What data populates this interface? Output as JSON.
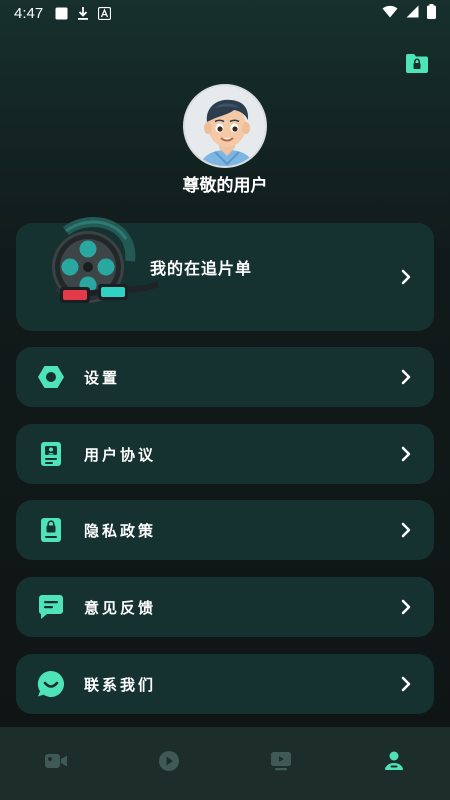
{
  "status_bar": {
    "time": "4:47"
  },
  "profile": {
    "username": "尊敬的用户"
  },
  "watchlist": {
    "label": "我的在追片单"
  },
  "menu": [
    {
      "label": "设置",
      "icon": "settings-icon"
    },
    {
      "label": "用户协议",
      "icon": "agreement-icon"
    },
    {
      "label": "隐私政策",
      "icon": "privacy-icon"
    },
    {
      "label": "意见反馈",
      "icon": "feedback-icon"
    },
    {
      "label": "联系我们",
      "icon": "contact-icon"
    }
  ],
  "bottom_nav": [
    {
      "icon": "video-camera-icon",
      "active": false
    },
    {
      "icon": "play-circle-icon",
      "active": false
    },
    {
      "icon": "tv-play-icon",
      "active": false
    },
    {
      "icon": "profile-icon",
      "active": true
    }
  ],
  "colors": {
    "accent": "#4fe3b8",
    "card": "#163230",
    "nav_inactive": "#3f5a55"
  }
}
